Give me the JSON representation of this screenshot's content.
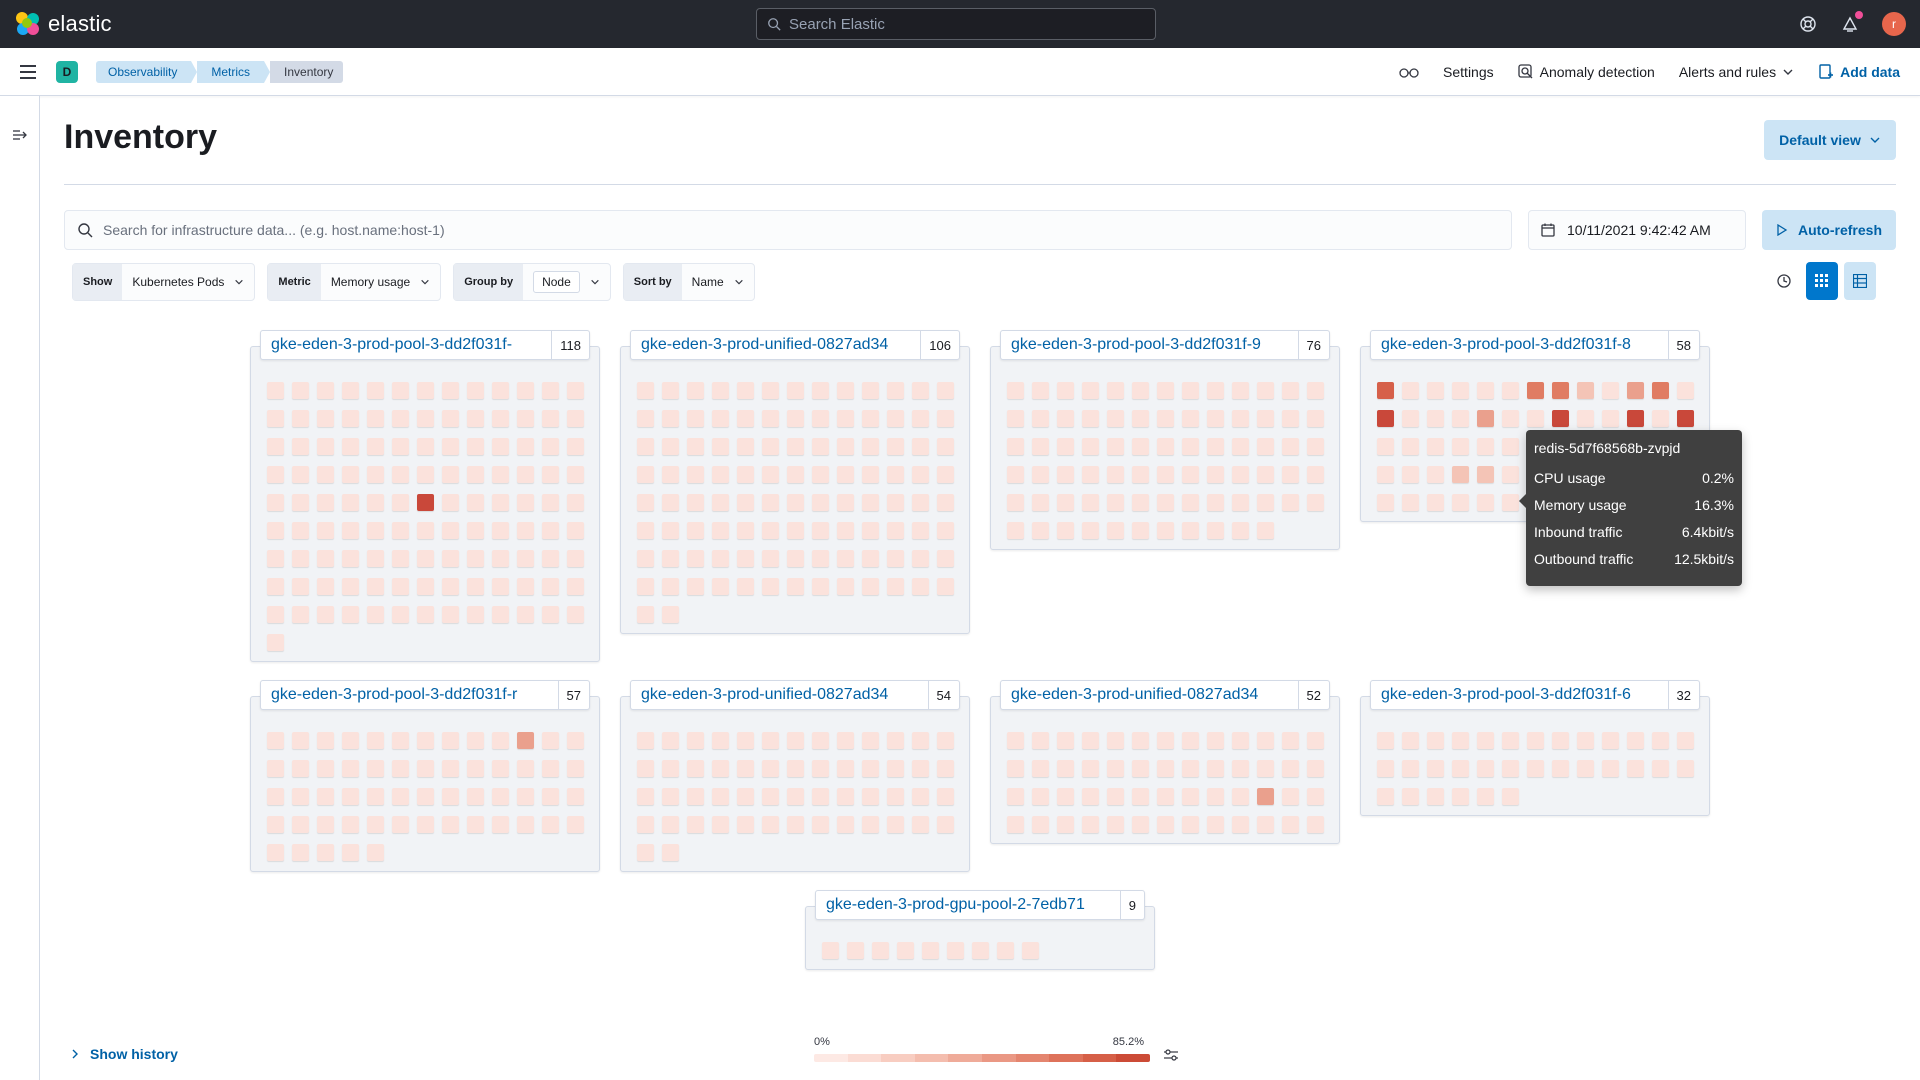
{
  "header": {
    "brand": "elastic",
    "search_placeholder": "Search Elastic",
    "avatar_initial": "r"
  },
  "subnav": {
    "space_initial": "D",
    "breadcrumbs": [
      "Observability",
      "Metrics",
      "Inventory"
    ],
    "settings": "Settings",
    "anomaly": "Anomaly detection",
    "alerts": "Alerts and rules",
    "add_data": "Add data"
  },
  "page": {
    "title": "Inventory",
    "default_view": "Default view",
    "search_placeholder": "Search for infrastructure data... (e.g. host.name:host-1)",
    "datetime": "10/11/2021 9:42:42 AM",
    "auto_refresh": "Auto-refresh"
  },
  "toolbar": {
    "show_label": "Show",
    "show_value": "Kubernetes Pods",
    "metric_label": "Metric",
    "metric_value": "Memory usage",
    "groupby_label": "Group by",
    "groupby_value": "Node",
    "sortby_label": "Sort by",
    "sortby_value": "Name"
  },
  "nodes": [
    {
      "name": "gke-eden-3-prod-pool-3-dd2f031f-",
      "count": "118"
    },
    {
      "name": "gke-eden-3-prod-unified-0827ad34",
      "count": "106"
    },
    {
      "name": "gke-eden-3-prod-pool-3-dd2f031f-9",
      "count": "76"
    },
    {
      "name": "gke-eden-3-prod-pool-3-dd2f031f-8",
      "count": "58"
    },
    {
      "name": "gke-eden-3-prod-pool-3-dd2f031f-r",
      "count": "57"
    },
    {
      "name": "gke-eden-3-prod-unified-0827ad34",
      "count": "54"
    },
    {
      "name": "gke-eden-3-prod-unified-0827ad34",
      "count": "52"
    },
    {
      "name": "gke-eden-3-prod-pool-3-dd2f031f-6",
      "count": "32"
    },
    {
      "name": "gke-eden-3-prod-gpu-pool-2-7edb71",
      "count": "9"
    }
  ],
  "tooltip": {
    "title": "redis-5d7f68568b-zvpjd",
    "rows": [
      {
        "label": "CPU usage",
        "value": "0.2%"
      },
      {
        "label": "Memory usage",
        "value": "16.3%"
      },
      {
        "label": "Inbound traffic",
        "value": "6.4kbit/s"
      },
      {
        "label": "Outbound traffic",
        "value": "12.5kbit/s"
      }
    ]
  },
  "footer": {
    "show_history": "Show history",
    "legend_min": "0%",
    "legend_max": "85.2%"
  },
  "colors": {
    "accent": "#0077cc",
    "heat_scale": [
      "#fbe2dc",
      "#f4c4b6",
      "#eaa08d",
      "#e07c63",
      "#d6604a",
      "#c9483a"
    ]
  }
}
